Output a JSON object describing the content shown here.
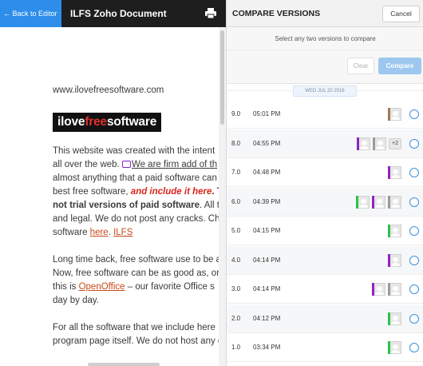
{
  "editor": {
    "back_label": "← Back to Editor",
    "doc_title": "ILFS Zoho Document",
    "print_icon": "printer-icon"
  },
  "doc": {
    "site_url": "www.ilovefreesoftware.com",
    "logo": {
      "part1": "ilove",
      "part2": "free",
      "part3": "software"
    },
    "p1": {
      "l1": "This website was created with the intent",
      "l2a": "all over the web. ",
      "l2b": "We",
      "l2c": " are firm add of th",
      "l3": "almost anything that a paid software can",
      "l4a": "best free software, ",
      "l4b": "and include it here",
      "l4c": ". Th",
      "l5a": "not trial versions of paid software",
      "l5b": ". All th",
      "l6": "and legal. We do not post any cracks. Che",
      "l7a": "software ",
      "l7b": "here",
      "l7c": ". ",
      "l7d": "ILFS"
    },
    "p2": {
      "l1": "Long time back, free software use to be a",
      "l2": "Now, free software can be as good as, or",
      "l3a": "this is ",
      "l3b": "OpenOffice",
      "l3c": " – our favorite Office s",
      "l4": "day by day."
    },
    "p3": {
      "l1": "For all the software that we include here",
      "l2": "program page itself. We do not host any c"
    }
  },
  "compare": {
    "title": "COMPARE VERSIONS",
    "cancel_label": "Cancel",
    "instruction": "Select any two versions to compare",
    "clear_label": "Clear",
    "compare_label": "Compare",
    "date_label": "WED JUL 20 2016",
    "versions": [
      {
        "num": "9.0",
        "time": "05:01 PM",
        "avatars": [
          "#a07850"
        ],
        "more": ""
      },
      {
        "num": "8.0",
        "time": "04:55 PM",
        "avatars": [
          "#8e24c6",
          "#9a9a9a"
        ],
        "more": "+2"
      },
      {
        "num": "7.0",
        "time": "04:48 PM",
        "avatars": [
          "#8e24c6"
        ],
        "more": ""
      },
      {
        "num": "6.0",
        "time": "04:39 PM",
        "avatars": [
          "#2cc24a",
          "#8e24c6",
          "#9a9a9a"
        ],
        "more": ""
      },
      {
        "num": "5.0",
        "time": "04:15 PM",
        "avatars": [
          "#2cc24a"
        ],
        "more": ""
      },
      {
        "num": "4.0",
        "time": "04:14 PM",
        "avatars": [
          "#8e24c6"
        ],
        "more": ""
      },
      {
        "num": "3.0",
        "time": "04:14 PM",
        "avatars": [
          "#8e24c6",
          "#9a9a9a"
        ],
        "more": ""
      },
      {
        "num": "2.0",
        "time": "04:12 PM",
        "avatars": [
          "#2cc24a"
        ],
        "more": ""
      },
      {
        "num": "1.0",
        "time": "03:34 PM",
        "avatars": [
          "#2cc24a"
        ],
        "more": ""
      }
    ]
  },
  "colors": {
    "accent_blue": "#2c8eea",
    "compare_btn": "#9ec7ef",
    "topbar": "#1e1e1e",
    "logo_red": "#e0312f"
  }
}
